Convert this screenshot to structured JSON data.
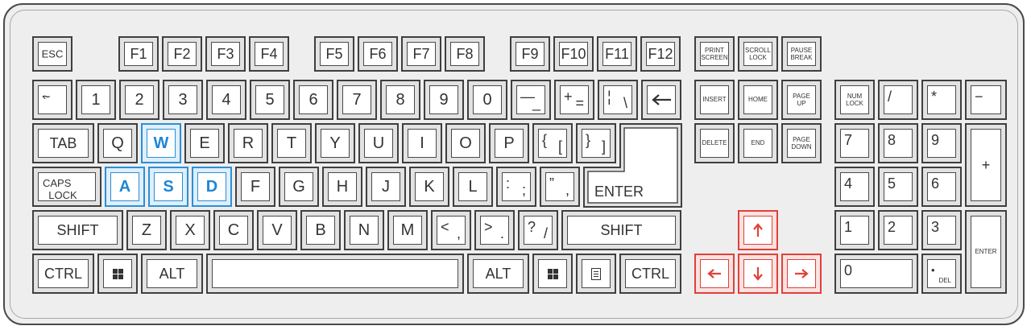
{
  "colors": {
    "highlight_blue": "#1e86d6",
    "highlight_red": "#e0413a",
    "outline": "#3f3f3f"
  },
  "keys": {
    "esc": "ESC",
    "f1": "F1",
    "f2": "F2",
    "f3": "F3",
    "f4": "F4",
    "f5": "F5",
    "f6": "F6",
    "f7": "F7",
    "f8": "F8",
    "f9": "F9",
    "f10": "F10",
    "f11": "F11",
    "f12": "F12",
    "print_screen": "PRINT\nSCREEN",
    "scroll_lock": "SCROLL\nLOCK",
    "pause_break": "PAUSE\nBREAK",
    "tilde_top": "~",
    "tilde_bottom": "`",
    "n1": "1",
    "n2": "2",
    "n3": "3",
    "n4": "4",
    "n5": "5",
    "n6": "6",
    "n7": "7",
    "n8": "8",
    "n9": "9",
    "n0": "0",
    "minus_top": "—",
    "minus_bottom": "_",
    "equals_top": "+",
    "equals_bottom": "=",
    "pipe_top": "¦",
    "pipe_bottom": "\\",
    "tab": "TAB",
    "q": "Q",
    "w": "W",
    "e": "E",
    "r": "R",
    "t": "T",
    "y": "Y",
    "u": "U",
    "i": "I",
    "o": "O",
    "p": "P",
    "lbrace_top": "{",
    "lbrace_bottom": "[",
    "rbrace_top": "}",
    "rbrace_bottom": "]",
    "caps_lock": "CAPS\n  LOCK",
    "a": "A",
    "s": "S",
    "d": "D",
    "f": "F",
    "g": "G",
    "h": "H",
    "j": "J",
    "k": "K",
    "l": "L",
    "colon_top": ":",
    "colon_bottom": ";",
    "quote_top": "”",
    "quote_bottom": ",",
    "enter": "ENTER",
    "shift_left": "SHIFT",
    "z": "Z",
    "x": "X",
    "c": "C",
    "v": "V",
    "b": "B",
    "n": "N",
    "m": "M",
    "lt_top": "<",
    "lt_bottom": ",",
    "gt_top": ">",
    "gt_bottom": ".",
    "qmark_top": "?",
    "qmark_bottom": "/",
    "shift_right": "SHIFT",
    "ctrl_left": "CTRL",
    "alt_left": "ALT",
    "alt_right": "ALT",
    "ctrl_right": "CTRL",
    "insert": "INSERT",
    "home": "HOME",
    "page_up": "PAGE\nUP",
    "delete": "DELETE",
    "end": "END",
    "page_down": "PAGE\nDOWN",
    "num_lock": "NUM\nLOCK",
    "num_slash": "/",
    "num_star": "*",
    "num_minus": "−",
    "num7": "7",
    "num8": "8",
    "num9": "9",
    "num_plus": "+",
    "num4": "4",
    "num5": "5",
    "num6": "6",
    "num1": "1",
    "num2": "2",
    "num3": "3",
    "num_enter": "ENTER",
    "num0": "0",
    "num_dot": "•",
    "num_del": "DEL"
  },
  "icons": {
    "backspace": "arrow-left-icon",
    "win": "windows-icon",
    "menu": "menu-icon",
    "up": "arrow-up-icon",
    "down": "arrow-down-icon",
    "left": "arrow-left-icon",
    "right": "arrow-right-icon"
  }
}
